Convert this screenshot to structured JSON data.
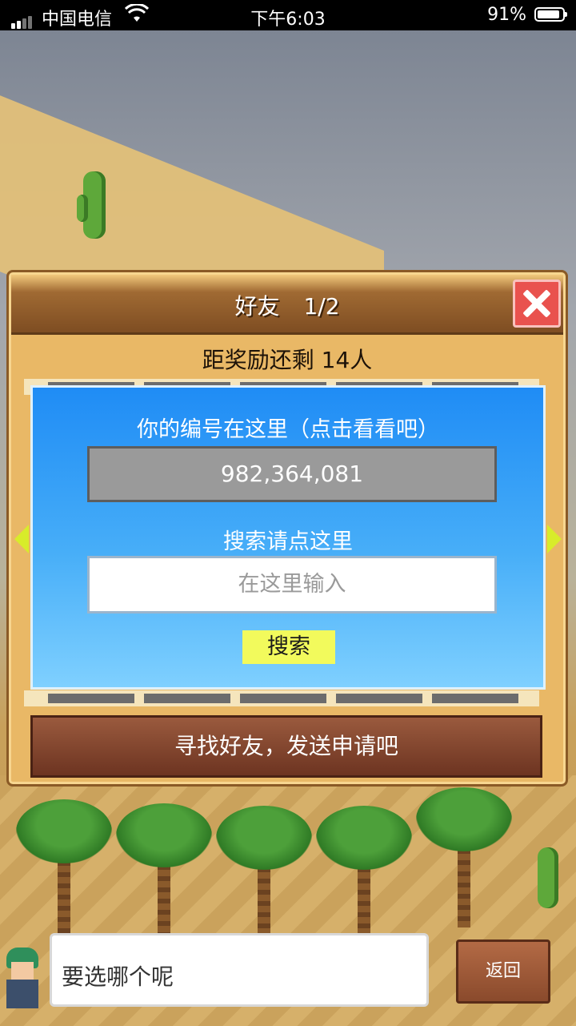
{
  "status_bar": {
    "carrier": "中国电信",
    "time": "下午6:03",
    "battery_percent": "91%",
    "battery_level": 0.91
  },
  "dialog": {
    "title": "好友",
    "page": "1/2",
    "reward_text": "距奖励还剩 14人",
    "panel": {
      "id_label": "你的编号在这里（点击看看吧）",
      "id_value": "982,364,081",
      "search_label": "搜索请点这里",
      "search_placeholder": "在这里输入",
      "search_button": "搜索"
    },
    "find_friends_button": "寻找好友，发送申请吧"
  },
  "bottom": {
    "speech_text": "要选哪个呢",
    "back_button": "返回"
  },
  "colors": {
    "panel_blue": "#1f8cf5",
    "close_red": "#e9524e",
    "search_button_yellow": "#f2fa5c",
    "dialog_frame": "#e9b866"
  },
  "icons": [
    "signal-icon",
    "wifi-icon",
    "battery-icon",
    "close-icon",
    "arrow-left-icon",
    "arrow-right-icon"
  ]
}
